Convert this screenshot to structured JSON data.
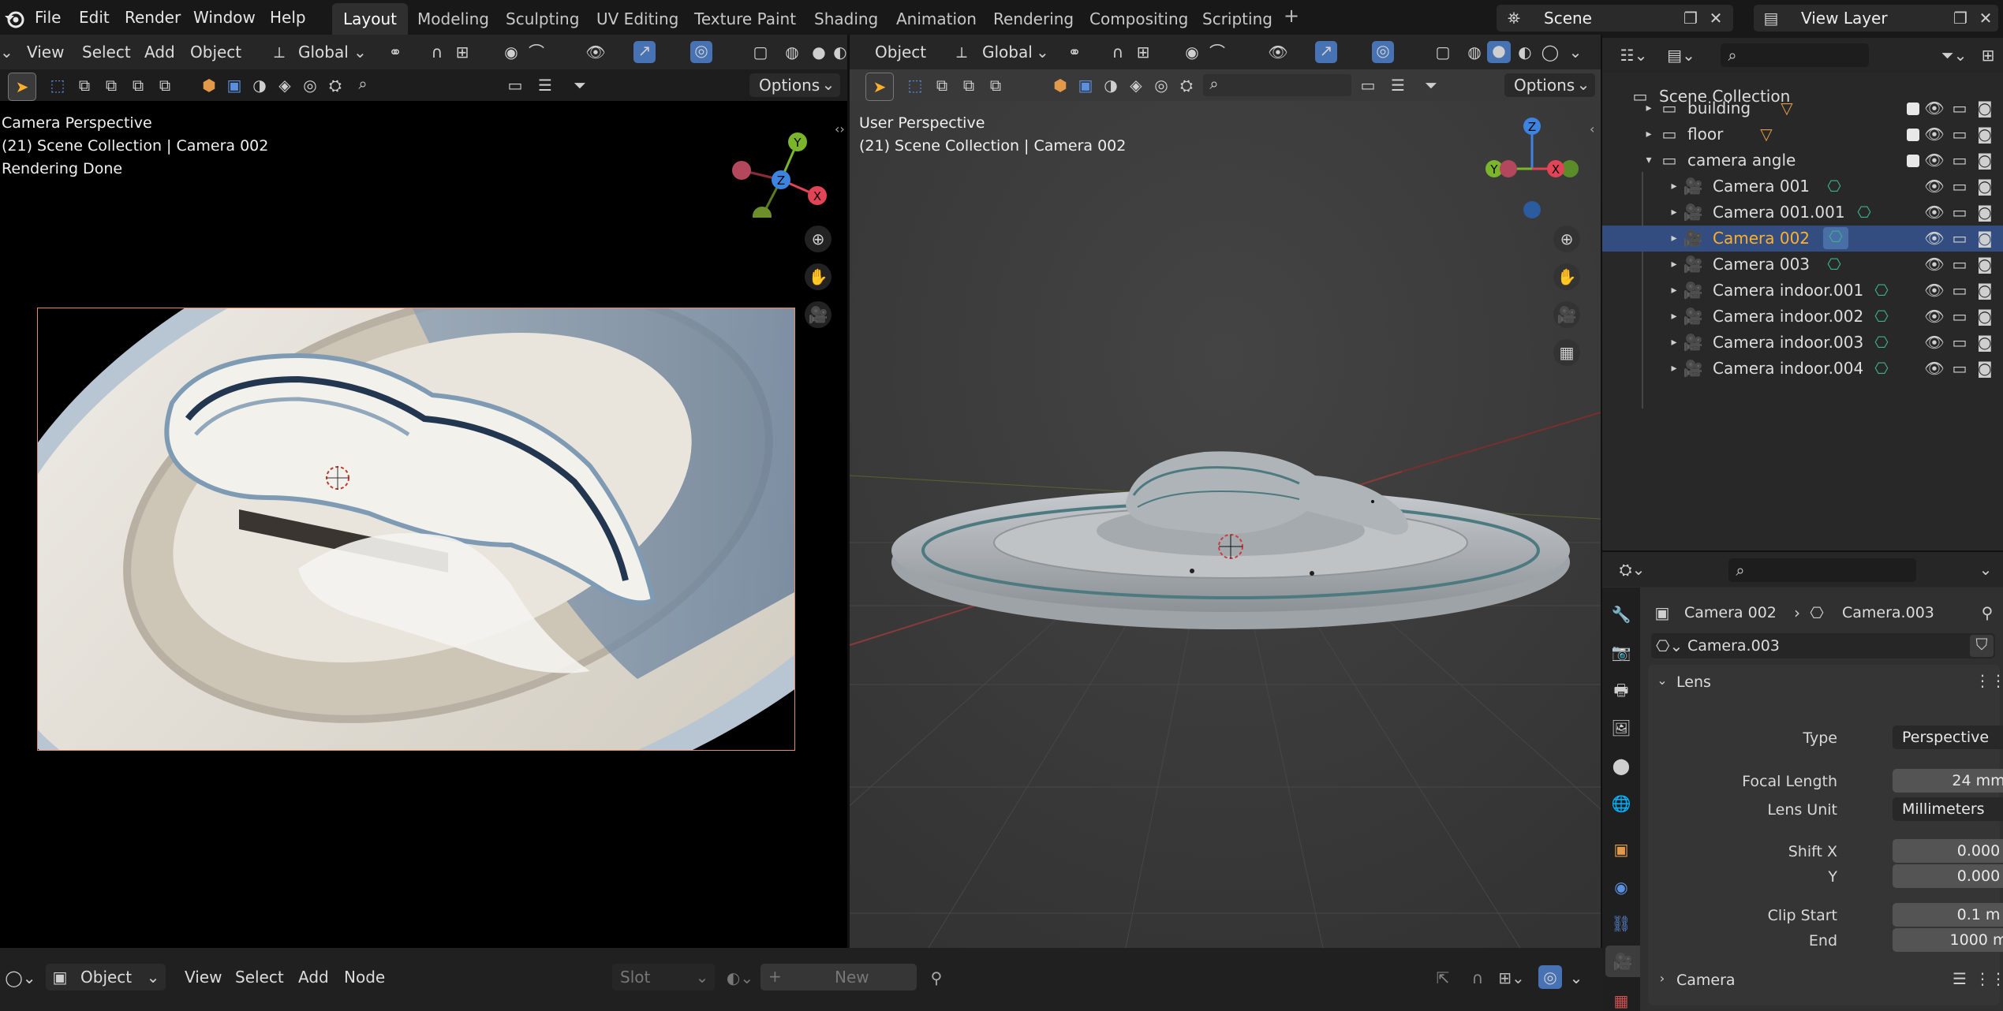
{
  "menubar": {
    "menus": [
      "File",
      "Edit",
      "Render",
      "Window",
      "Help"
    ],
    "workspaces": [
      "Layout",
      "Modeling",
      "Sculpting",
      "UV Editing",
      "Texture Paint",
      "Shading",
      "Animation",
      "Rendering",
      "Compositing",
      "Scripting"
    ],
    "active_workspace": "Layout",
    "add_tab": "+",
    "scene": "Scene",
    "view_layer": "View Layer"
  },
  "left_viewport": {
    "header_menus": [
      "View",
      "Select",
      "Add",
      "Object"
    ],
    "orientation": "Global",
    "options_label": "Options",
    "overlay_line1": "Camera Perspective",
    "overlay_line2": "(21) Scene Collection | Camera 002",
    "overlay_line3": "Rendering Done",
    "gizmo": {
      "y": "Y",
      "z": "Z",
      "x": "X"
    }
  },
  "right_viewport": {
    "header_menus": [
      "Object"
    ],
    "orientation": "Global",
    "options_label": "Options",
    "overlay_line1": "User Perspective",
    "overlay_line2": "(21) Scene Collection | Camera 002",
    "gizmo": {
      "y": "Y",
      "z": "Z",
      "x": "X"
    }
  },
  "outliner": {
    "root": "Scene Collection",
    "collections": [
      {
        "name": "building",
        "expanded": false
      },
      {
        "name": "floor",
        "expanded": false
      },
      {
        "name": "camera angle",
        "expanded": true
      }
    ],
    "cameras": [
      "Camera 001",
      "Camera 001.001",
      "Camera 002",
      "Camera 003",
      "Camera indoor.001",
      "Camera indoor.002",
      "Camera indoor.003",
      "Camera indoor.004"
    ],
    "selected": "Camera 002"
  },
  "properties": {
    "breadcrumb_object": "Camera 002",
    "breadcrumb_data": "Camera.003",
    "datablock": "Camera.003",
    "lens_panel": "Lens",
    "type_label": "Type",
    "type_value": "Perspective",
    "focal_label": "Focal Length",
    "focal_value": "24 mm",
    "lens_unit_label": "Lens Unit",
    "lens_unit_value": "Millimeters",
    "shiftx_label": "Shift X",
    "shiftx_value": "0.000",
    "shifty_label": "Y",
    "shifty_value": "0.000",
    "clip_start_label": "Clip Start",
    "clip_start_value": "0.1 m",
    "clip_end_label": "End",
    "clip_end_value": "1000 m",
    "camera_panel": "Camera"
  },
  "bottombar": {
    "mode": "Object",
    "menus": [
      "View",
      "Select",
      "Add",
      "Node"
    ],
    "slot": "Slot",
    "new_label": "New"
  },
  "colors": {
    "accent": "#4772b3",
    "selected_text": "#ffaf29",
    "camera_icon": "#e29a4a",
    "data_icon": "#3db08c"
  }
}
